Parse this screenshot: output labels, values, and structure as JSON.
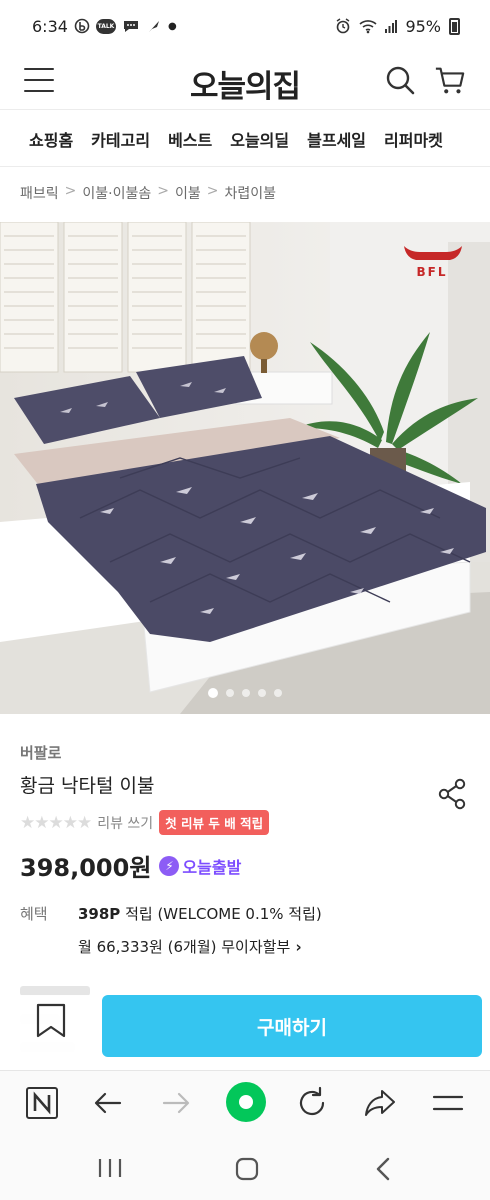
{
  "status_bar": {
    "time": "6:34",
    "battery": "95%",
    "talk_badge": "TALK"
  },
  "header": {
    "logo": "오늘의집",
    "icons": [
      "menu-icon",
      "search-icon",
      "cart-icon"
    ]
  },
  "category_nav": {
    "items": [
      "쇼핑홈",
      "카테고리",
      "베스트",
      "오늘의딜",
      "블프세일",
      "리퍼마켓"
    ]
  },
  "breadcrumb": [
    "패브릭",
    "이불·이불솜",
    "이불",
    "차렵이불"
  ],
  "product_image": {
    "brand_mark": "BFL",
    "slide_count": 5,
    "active_slide": 1,
    "accent_color": "#c62828"
  },
  "product": {
    "brand": "버팔로",
    "name": "황금 낙타털 이불",
    "rating_stars": 0,
    "review_link": "리뷰 쓰기",
    "review_badge": "첫 리뷰 두 배 적립",
    "price": "398,000원",
    "delivery_badge": "오늘출발",
    "delivery_color": "#7c4dff"
  },
  "benefit": {
    "label": "혜택",
    "points": "398P",
    "points_text": " 적립 (WELCOME 0.1% 적립)",
    "installment": "월 66,333원 (6개월) 무이자할부"
  },
  "buy_bar": {
    "buy_label": "구매하기",
    "buy_color": "#35c5f0"
  },
  "browser_toolbar": {
    "icons": [
      "naver-n-icon",
      "back-arrow-icon",
      "forward-arrow-icon",
      "home-green-icon",
      "refresh-icon",
      "share-arrow-icon",
      "menu-lines-icon"
    ]
  },
  "system_nav": {
    "icons": [
      "recents-icon",
      "home-icon",
      "back-icon"
    ]
  }
}
